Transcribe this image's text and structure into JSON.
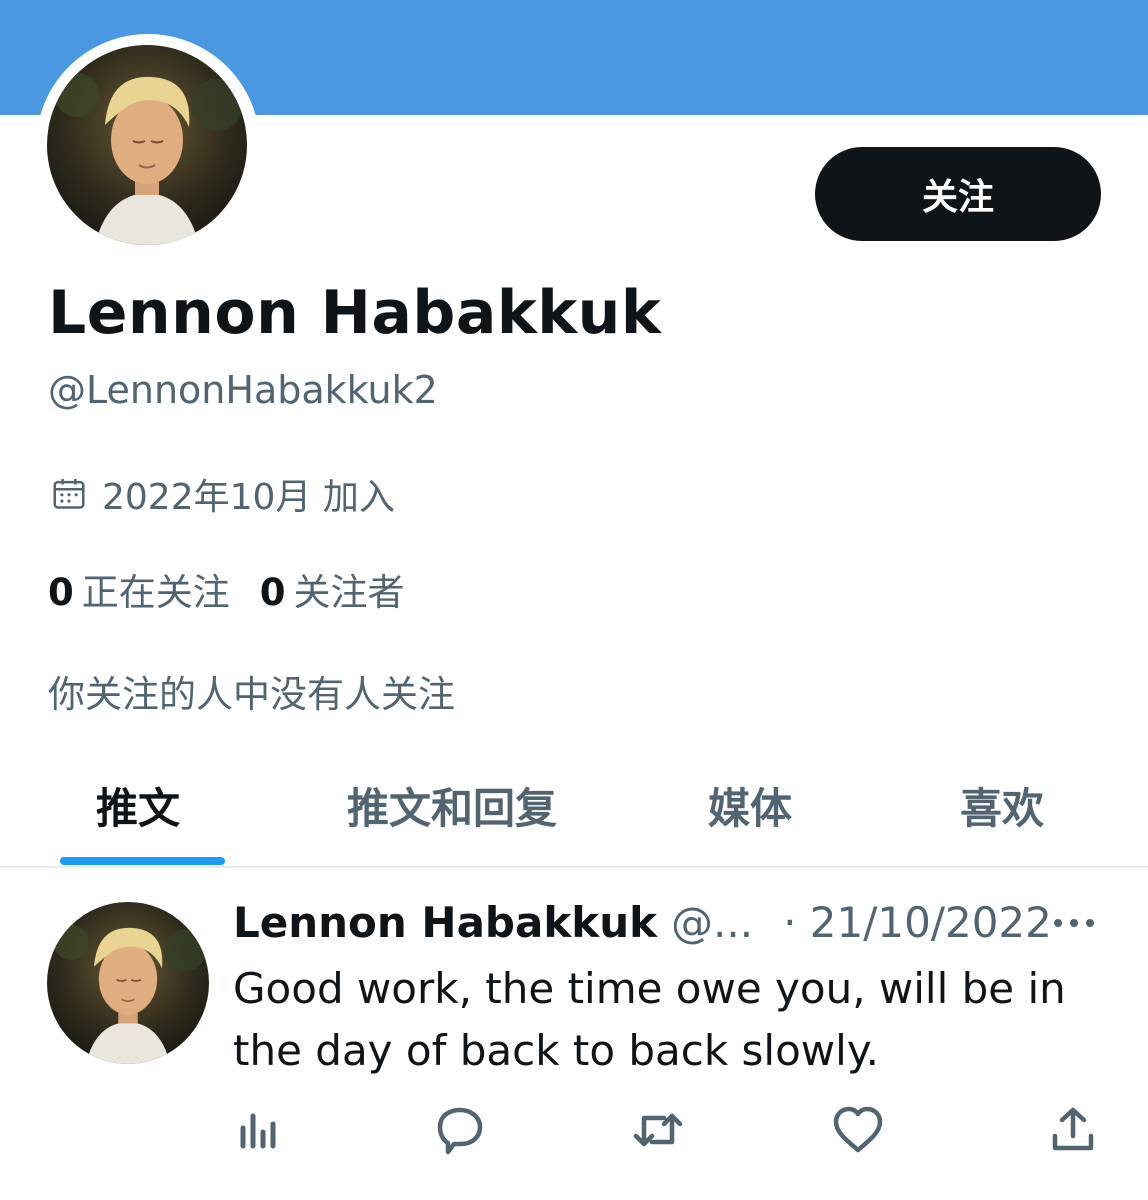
{
  "colors": {
    "banner": "#4a97e2",
    "follow_button_bg": "#0f1419",
    "follow_button_text": "#ffffff",
    "secondary_text": "#536471",
    "accent": "#1d9bf0",
    "icon": "#536471"
  },
  "profile": {
    "follow_label": "关注",
    "display_name": "Lennon Habakkuk",
    "handle": "@LennonHabakkuk2",
    "joined_icon": "calendar-icon",
    "joined_text": "2022年10月 加入",
    "following_count": "0",
    "following_label": "正在关注",
    "followers_count": "0",
    "followers_label": "关注者",
    "mutual_text": "你关注的人中没有人关注"
  },
  "tabs": [
    {
      "label": "推文",
      "active": true
    },
    {
      "label": "推文和回复",
      "active": false
    },
    {
      "label": "媒体",
      "active": false
    },
    {
      "label": "喜欢",
      "active": false
    }
  ],
  "tweet": {
    "author_name": "Lennon Habakkuk",
    "author_handle": "@...",
    "date": "· 21/10/2022",
    "text": "Good work, the time owe you, will be in the day of back to back slowly.",
    "more_icon": "more-dots-icon",
    "actions": [
      "analytics-icon",
      "reply-icon",
      "retweet-icon",
      "like-icon",
      "share-icon"
    ]
  }
}
